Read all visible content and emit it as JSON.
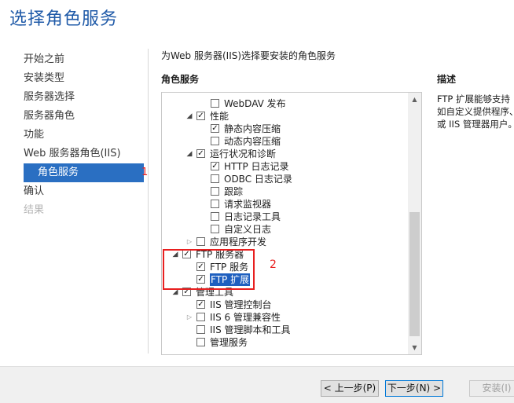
{
  "page_title": "选择角色服务",
  "nav": {
    "items": [
      {
        "label": "开始之前",
        "state": "normal"
      },
      {
        "label": "安装类型",
        "state": "normal"
      },
      {
        "label": "服务器选择",
        "state": "normal"
      },
      {
        "label": "服务器角色",
        "state": "normal"
      },
      {
        "label": "功能",
        "state": "normal"
      },
      {
        "label": "Web 服务器角色(IIS)",
        "state": "normal"
      },
      {
        "label": "角色服务",
        "state": "selected"
      },
      {
        "label": "确认",
        "state": "normal"
      },
      {
        "label": "结果",
        "state": "disabled"
      }
    ],
    "annotation": "1"
  },
  "main": {
    "instruction": "为Web 服务器(IIS)选择要安装的角色服务",
    "roles_heading": "角色服务",
    "desc_heading": "描述",
    "description_lines": [
      "FTP 扩展能够支持",
      "如自定义提供程序、",
      "或 IIS 管理器用户。"
    ],
    "annotation": "2"
  },
  "tree": {
    "rows": [
      {
        "indent": 3,
        "expander": "",
        "checked": false,
        "label": "WebDAV 发布"
      },
      {
        "indent": 2,
        "expander": "expanded",
        "checked": true,
        "label": "性能"
      },
      {
        "indent": 3,
        "expander": "",
        "checked": true,
        "label": "静态内容压缩"
      },
      {
        "indent": 3,
        "expander": "",
        "checked": false,
        "label": "动态内容压缩"
      },
      {
        "indent": 2,
        "expander": "expanded",
        "checked": true,
        "label": "运行状况和诊断"
      },
      {
        "indent": 3,
        "expander": "",
        "checked": true,
        "label": "HTTP 日志记录"
      },
      {
        "indent": 3,
        "expander": "",
        "checked": false,
        "label": "ODBC 日志记录"
      },
      {
        "indent": 3,
        "expander": "",
        "checked": false,
        "label": "跟踪"
      },
      {
        "indent": 3,
        "expander": "",
        "checked": false,
        "label": "请求监视器"
      },
      {
        "indent": 3,
        "expander": "",
        "checked": false,
        "label": "日志记录工具"
      },
      {
        "indent": 3,
        "expander": "",
        "checked": false,
        "label": "自定义日志"
      },
      {
        "indent": 2,
        "expander": "collapsed",
        "checked": false,
        "label": "应用程序开发"
      },
      {
        "indent": 1,
        "expander": "expanded",
        "checked": true,
        "label": "FTP 服务器"
      },
      {
        "indent": 2,
        "expander": "",
        "checked": true,
        "label": "FTP 服务"
      },
      {
        "indent": 2,
        "expander": "",
        "checked": true,
        "label": "FTP 扩展",
        "highlight": true
      },
      {
        "indent": 1,
        "expander": "expanded",
        "checked": true,
        "label": "管理工具"
      },
      {
        "indent": 2,
        "expander": "",
        "checked": true,
        "label": "IIS 管理控制台"
      },
      {
        "indent": 2,
        "expander": "collapsed",
        "checked": false,
        "label": "IIS 6 管理兼容性"
      },
      {
        "indent": 2,
        "expander": "",
        "checked": false,
        "label": "IIS 管理脚本和工具"
      },
      {
        "indent": 2,
        "expander": "",
        "checked": false,
        "label": "管理服务"
      }
    ]
  },
  "buttons": {
    "prev": "< 上一步(P)",
    "next": "下一步(N) >",
    "install": "安装(I)"
  },
  "icons": {
    "expanded": "◢",
    "collapsed": "▷",
    "check": "✓",
    "scroll_up": "▲",
    "scroll_down": "▼"
  }
}
